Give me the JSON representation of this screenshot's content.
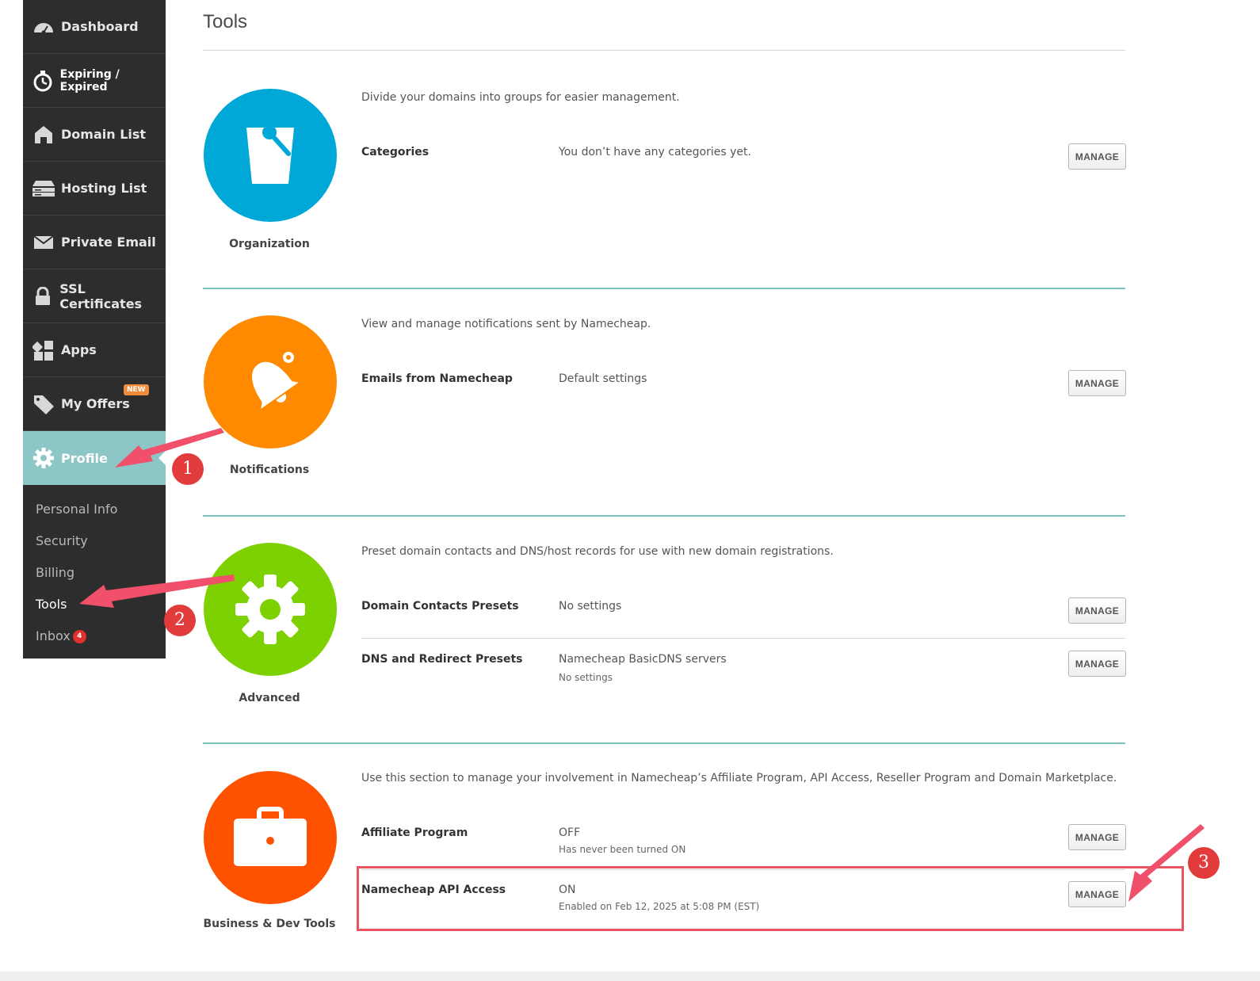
{
  "sidebar": {
    "items": [
      {
        "label": "Dashboard",
        "icon": "gauge-icon"
      },
      {
        "label": "Expiring / Expired",
        "icon": "stopwatch-icon"
      },
      {
        "label": "Domain List",
        "icon": "home-icon"
      },
      {
        "label": "Hosting List",
        "icon": "server-icon"
      },
      {
        "label": "Private Email",
        "icon": "envelope-icon"
      },
      {
        "label": "SSL Certificates",
        "icon": "lock-icon"
      },
      {
        "label": "Apps",
        "icon": "apps-grid-icon"
      },
      {
        "label": "My Offers",
        "icon": "tag-icon",
        "badge": "NEW"
      },
      {
        "label": "Profile",
        "icon": "gear-icon",
        "active": true
      }
    ],
    "subitems": [
      {
        "label": "Personal Info"
      },
      {
        "label": "Security"
      },
      {
        "label": "Billing"
      },
      {
        "label": "Tools",
        "current": true
      },
      {
        "label": "Inbox",
        "count": "4"
      }
    ]
  },
  "page": {
    "title": "Tools"
  },
  "sections": [
    {
      "name": "Organization",
      "color": "#00a8d8",
      "icon": "bucket-icon",
      "description": "Divide your domains into groups for easier management.",
      "rows": [
        {
          "label": "Categories",
          "value": "You don’t have any categories yet.",
          "sub": "",
          "button": "MANAGE"
        }
      ]
    },
    {
      "name": "Notifications",
      "color": "#ff8a00",
      "icon": "bell-icon",
      "description": "View and manage notifications sent by Namecheap.",
      "rows": [
        {
          "label": "Emails from Namecheap",
          "value": "Default settings",
          "sub": "",
          "button": "MANAGE"
        }
      ]
    },
    {
      "name": "Advanced",
      "color": "#7ed100",
      "icon": "cog-icon",
      "description": "Preset domain contacts and DNS/host records for use with new domain registrations.",
      "rows": [
        {
          "label": "Domain Contacts Presets",
          "value": "No settings",
          "sub": "",
          "button": "MANAGE"
        },
        {
          "label": "DNS and Redirect Presets",
          "value": "Namecheap BasicDNS servers",
          "sub": "No settings",
          "button": "MANAGE"
        }
      ]
    },
    {
      "name": "Business & Dev Tools",
      "color": "#ff5200",
      "icon": "briefcase-icon",
      "description": "Use this section to manage your involvement in Namecheap’s Affiliate Program, API Access, Reseller Program and Domain Marketplace.",
      "rows": [
        {
          "label": "Affiliate Program",
          "value": "OFF",
          "sub": "Has never been turned ON",
          "button": "MANAGE"
        },
        {
          "label": "Namecheap API Access",
          "value": "ON",
          "sub": "Enabled on Feb 12, 2025 at 5:08 PM (EST)",
          "button": "MANAGE"
        }
      ]
    }
  ],
  "annotations": {
    "steps": [
      "1",
      "2",
      "3"
    ],
    "color": "#e23b3b",
    "arrow_color": "#f0506a"
  }
}
